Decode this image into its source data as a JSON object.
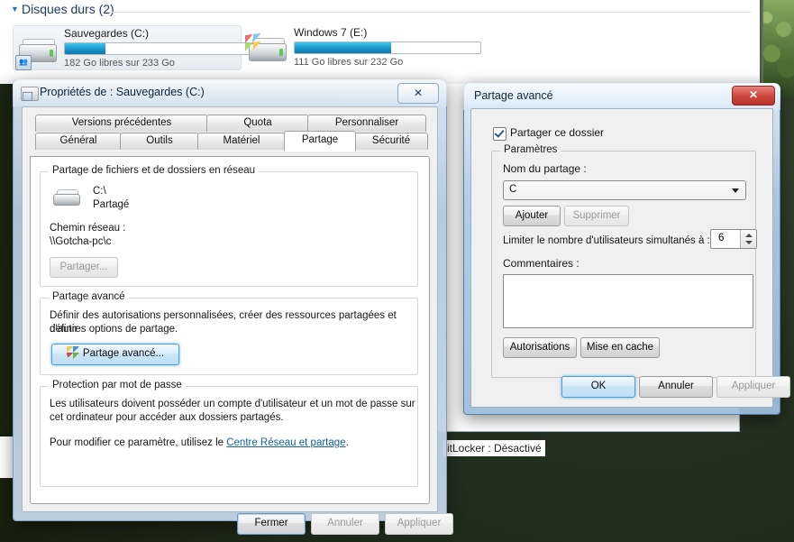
{
  "explorer": {
    "group_header": "Disques durs (2)",
    "triangle_icon": "collapse-triangle-icon",
    "drives": [
      {
        "name": "Sauvegardes (C:)",
        "free_text": "182 Go libres sur 233 Go",
        "free_gb": 182,
        "total_gb": 233,
        "used_percent": 22,
        "icon": "hard-drive-icon",
        "overlay_icon": "shared-folder-overlay-icon",
        "selected": true
      },
      {
        "name": "Windows 7 (E:)",
        "free_text": "111 Go libres sur 232 Go",
        "free_gb": 111,
        "total_gb": 232,
        "used_percent": 52,
        "icon": "hard-drive-windows-icon",
        "overlay_icon": "windows-logo-overlay-icon",
        "selected": false
      }
    ],
    "bitlocker_status": "itLocker : Désactivé"
  },
  "properties_dialog": {
    "title": "Propriétés de : Sauvegardes (C:)",
    "window_icon": "drive-properties-icon",
    "close_label": "✕",
    "tabs_row1": [
      {
        "label": "Versions précédentes",
        "active": false
      },
      {
        "label": "Quota",
        "active": false
      },
      {
        "label": "Personnaliser",
        "active": false
      }
    ],
    "tabs_row2": [
      {
        "label": "Général",
        "active": false
      },
      {
        "label": "Outils",
        "active": false
      },
      {
        "label": "Matériel",
        "active": false
      },
      {
        "label": "Partage",
        "active": true
      },
      {
        "label": "Sécurité",
        "active": false
      }
    ],
    "network_group": {
      "legend": "Partage de fichiers et de dossiers en réseau",
      "icon": "shared-drive-icon",
      "share_path": "C:\\",
      "share_state": "Partagé",
      "network_path_label": "Chemin réseau :",
      "network_path_value": "\\\\Gotcha-pc\\c",
      "share_button": "Partager...",
      "share_button_enabled": false
    },
    "advanced_group": {
      "legend": "Partage avancé",
      "description_line1": "Définir des autorisations personnalisées, créer des ressources partagées et définir",
      "description_line2": "d'autres options de partage.",
      "button_label": "Partage avancé...",
      "button_icon": "uac-shield-icon"
    },
    "password_group": {
      "legend": "Protection par mot de passe",
      "line1": "Les utilisateurs doivent posséder un compte d'utilisateur et un mot de passe sur",
      "line2": "cet ordinateur pour accéder aux dossiers partagés.",
      "line3_prefix": "Pour modifier ce paramètre, utilisez le ",
      "link_text": "Centre Réseau et partage",
      "line3_suffix": "."
    },
    "footer": {
      "close": "Fermer",
      "cancel": "Annuler",
      "apply": "Appliquer"
    }
  },
  "advanced_dialog": {
    "title": "Partage avancé",
    "close_label": "✕",
    "share_checkbox_label": "Partager ce dossier",
    "share_checkbox_checked": true,
    "settings_legend": "Paramètres",
    "share_name_label": "Nom du partage :",
    "share_name_value": "C",
    "add_button": "Ajouter",
    "remove_button": "Supprimer",
    "remove_enabled": false,
    "limit_label": "Limiter le nombre d'utilisateurs simultanés à :",
    "limit_value": "6",
    "comments_label": "Commentaires :",
    "comments_value": "",
    "permissions_button": "Autorisations",
    "caching_button": "Mise en cache",
    "footer": {
      "ok": "OK",
      "cancel": "Annuler",
      "apply": "Appliquer"
    }
  },
  "colors": {
    "accent_blue": "#1a93c9",
    "link_blue": "#14619b",
    "close_red": "#cf4b42",
    "header_blue": "#1b3c66"
  }
}
